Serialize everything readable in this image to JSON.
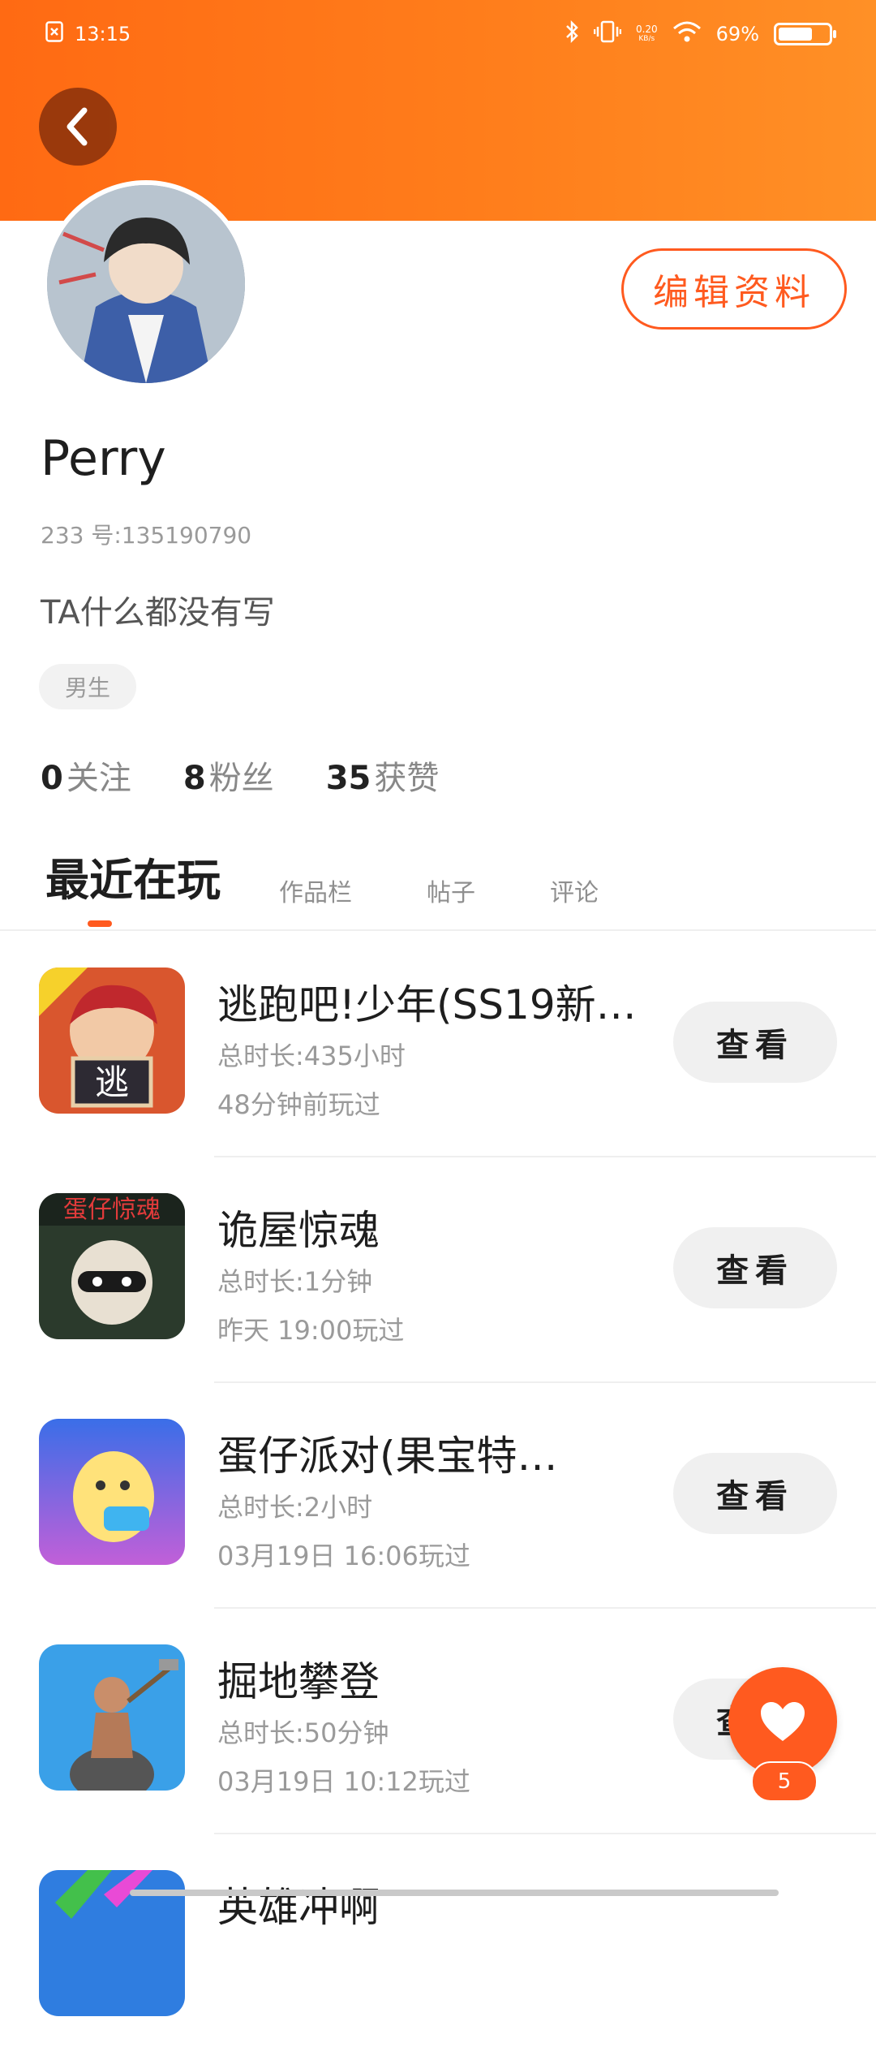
{
  "status_bar": {
    "time": "13:15",
    "net_speed_value": "0.20",
    "net_speed_unit": "KB/s",
    "battery_text": "69%",
    "battery_level": 0.69
  },
  "profile": {
    "name": "Perry",
    "uid": "233 号:135190790",
    "bio": "TA什么都没有写",
    "gender": "男生",
    "edit_label": "编辑资料"
  },
  "stats": [
    {
      "count": "0",
      "label": "关注"
    },
    {
      "count": "8",
      "label": "粉丝"
    },
    {
      "count": "35",
      "label": "获赞"
    }
  ],
  "tabs": [
    "最近在玩",
    "作品栏",
    "帖子",
    "评论"
  ],
  "games": [
    {
      "title": "逃跑吧!少年(SS19新…",
      "duration": "总时长:435小时",
      "last_played": "48分钟前玩过",
      "button": "查看",
      "icon": "escape-game-icon"
    },
    {
      "title": "诡屋惊魂",
      "duration": "总时长:1分钟",
      "last_played": "昨天 19:00玩过",
      "button": "查看",
      "icon": "haunted-house-game-icon"
    },
    {
      "title": "蛋仔派对(果宝特…",
      "duration": "总时长:2小时",
      "last_played": "03月19日 16:06玩过",
      "button": "查看",
      "icon": "eggy-party-game-icon"
    },
    {
      "title": "掘地攀登",
      "duration": "总时长:50分钟",
      "last_played": "03月19日 10:12玩过",
      "button": "查看",
      "icon": "getting-over-it-game-icon"
    },
    {
      "title": "英雄冲啊",
      "duration": "",
      "last_played": "",
      "button": "",
      "icon": "hero-game-icon"
    }
  ],
  "like_fab": {
    "count": "5",
    "icon": "heart-icon"
  },
  "colors": {
    "accent": "#ff5a1f",
    "header_start": "#ff6a13",
    "header_end": "#ff9026"
  }
}
